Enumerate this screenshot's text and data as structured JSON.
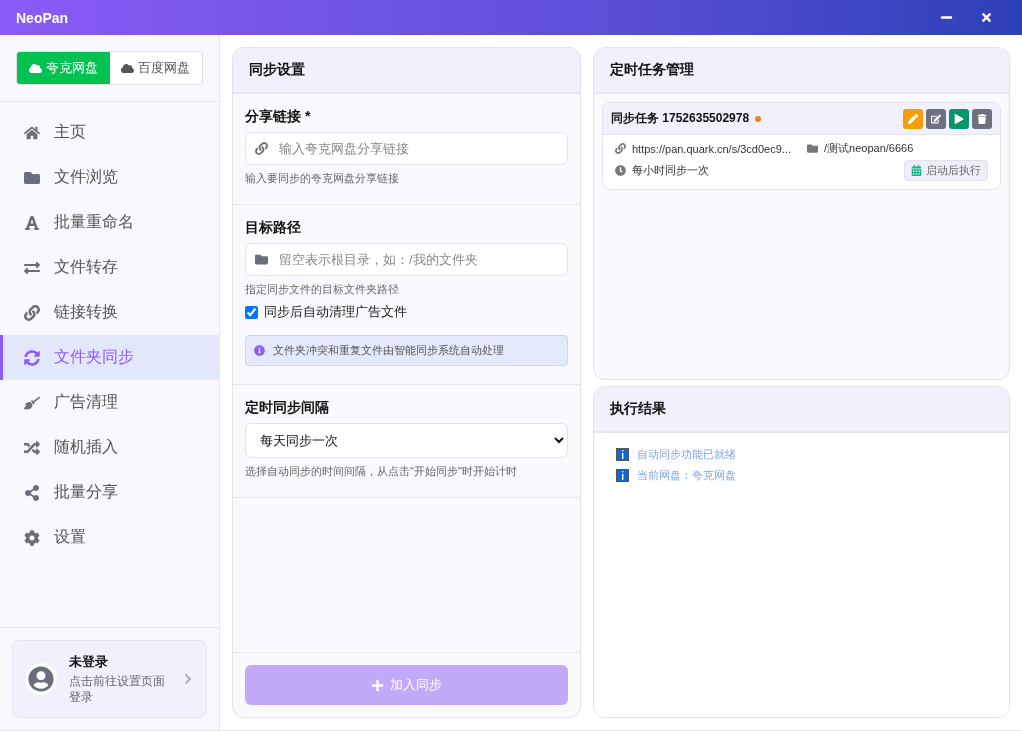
{
  "window": {
    "title": "NeoPan"
  },
  "sidebar": {
    "drives": [
      {
        "label": "夸克网盘",
        "selected": true
      },
      {
        "label": "百度网盘",
        "selected": false
      }
    ],
    "items": [
      {
        "label": "主页",
        "selected": false
      },
      {
        "label": "文件浏览",
        "selected": false
      },
      {
        "label": "批量重命名",
        "selected": false
      },
      {
        "label": "文件转存",
        "selected": false
      },
      {
        "label": "链接转换",
        "selected": false
      },
      {
        "label": "文件夹同步",
        "selected": true
      },
      {
        "label": "广告清理",
        "selected": false
      },
      {
        "label": "随机插入",
        "selected": false
      },
      {
        "label": "批量分享",
        "selected": false
      },
      {
        "label": "设置",
        "selected": false
      }
    ],
    "account": {
      "name": "未登录",
      "hint": "点击前往设置页面登录"
    }
  },
  "sync_settings": {
    "title": "同步设置",
    "share_link": {
      "label": "分享链接",
      "required_mark": "*",
      "placeholder": "输入夸克网盘分享链接",
      "help": "输入要同步的夸克网盘分享链接"
    },
    "target_path": {
      "label": "目标路径",
      "placeholder": "留空表示根目录，如：/我的文件夹",
      "help": "指定同步文件的目标文件夹路径",
      "checkbox": {
        "label": "同步后自动清理广告文件",
        "checked": true
      },
      "notice": "文件夹冲突和重复文件由智能同步系统自动处理"
    },
    "interval": {
      "label": "定时同步间隔",
      "value": "每天同步一次",
      "help": "选择自动同步的时间间隔，从点击\"开始同步\"时开始计时"
    },
    "submit": {
      "label": "加入同步",
      "disabled": true
    }
  },
  "tasks": {
    "title": "定时任务管理",
    "items": [
      {
        "name": "同步任务 1752635502978",
        "color": "#e8821e",
        "link": "https://pan.quark.cn/s/3cd0ec9...",
        "path": "/测试neopan/6666",
        "schedule": "每小时同步一次",
        "badge": "启动后执行"
      }
    ]
  },
  "results": {
    "title": "执行结果",
    "entries": [
      {
        "kind": "info",
        "text": "自动同步功能已就绪"
      },
      {
        "kind": "info",
        "text": "当前网盘：夸克网盘"
      }
    ]
  }
}
